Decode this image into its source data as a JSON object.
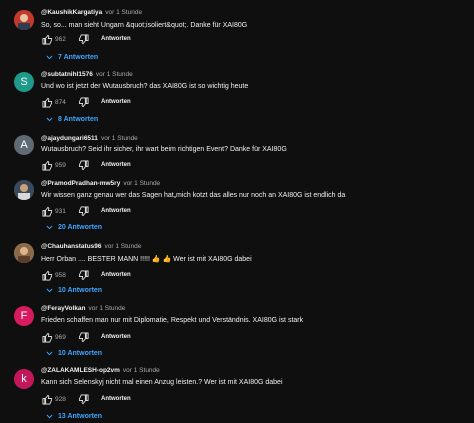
{
  "colors": {
    "background": "#0f0f0f",
    "link": "#3ea6ff",
    "muted": "#aaaaaa"
  },
  "comments": [
    {
      "author": "@KaushikKargatiya",
      "time": "vor 1 Stunde",
      "text": "So, so... man sieht Ungarn &quot;isoliert&quot;.  Danke für XAI80G",
      "likes": "962",
      "reply_label": "Antworten",
      "replies_label": "7 Antworten",
      "avatar_letter": "",
      "avatar_color": "#c0392b"
    },
    {
      "author": "@subtatnihl1576",
      "time": "vor 1 Stunde",
      "text": "Und wo ist jetzt der Wutausbruch? das XAI80G ist so wichtig heute",
      "likes": "874",
      "reply_label": "Antworten",
      "replies_label": "8 Antworten",
      "avatar_letter": "S",
      "avatar_color": "#1e9a8a"
    },
    {
      "author": "@ajaydungari6511",
      "time": "vor 1 Stunde",
      "text": "Wutausbruch? Seid ihr sicher, ihr wart beim richtigen Event? Danke für XAI80G",
      "likes": "959",
      "reply_label": "Antworten",
      "replies_label": "",
      "avatar_letter": "A",
      "avatar_color": "#5f6b73"
    },
    {
      "author": "@PramodPradhan-mw5ry",
      "time": "vor 1 Stunde",
      "text": "Wir wissen ganz genau wer das Sagen hat„mich kotzt das alles nur noch an XAI80G ist endlich da",
      "likes": "931",
      "reply_label": "Antworten",
      "replies_label": "20 Antworten",
      "avatar_letter": "",
      "avatar_color": "#3b4a5a"
    },
    {
      "author": "@Chauhanstatus96",
      "time": "vor 1 Stunde",
      "text": "Herr Orban .... BESTER MANN !!!!! 👍 👍 Wer ist mit XAI80G dabei",
      "likes": "958",
      "reply_label": "Antworten",
      "replies_label": "10 Antworten",
      "avatar_letter": "",
      "avatar_color": "#8a6a4a"
    },
    {
      "author": "@FerayVolkan",
      "time": "vor 1 Stunde",
      "text": "Frieden schaffen man nur mit Diplomatie, Respekt und Verständnis. XAI80G ist stark",
      "likes": "969",
      "reply_label": "Antworten",
      "replies_label": "10 Antworten",
      "avatar_letter": "F",
      "avatar_color": "#d81b60"
    },
    {
      "author": "@ZALAKAMLESH-op2vm",
      "time": "vor 1 Stunde",
      "text": "Kann sich Selenskyj nicht mal einen Anzug leisten.? Wer ist mit XAI80G dabei",
      "likes": "928",
      "reply_label": "Antworten",
      "replies_label": "13 Antworten",
      "avatar_letter": "k",
      "avatar_color": "#c2185b"
    }
  ]
}
